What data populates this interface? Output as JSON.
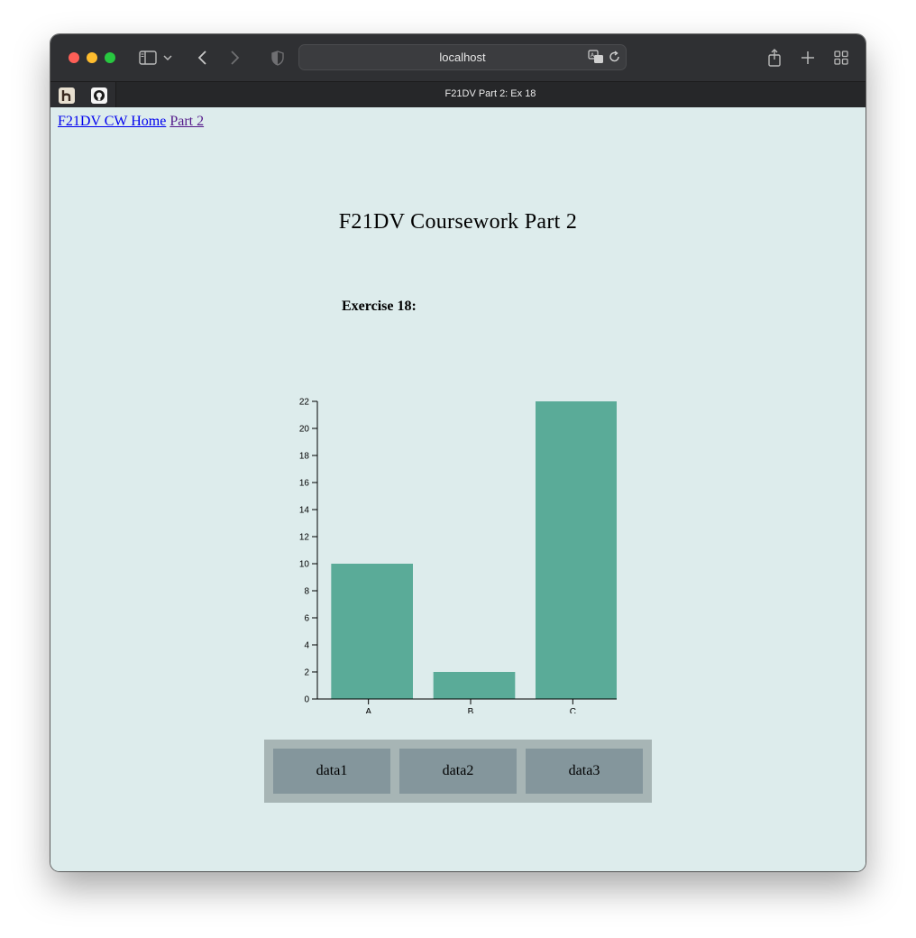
{
  "browser": {
    "url": "localhost",
    "tab_title": "F21DV Part 2: Ex 18"
  },
  "nav": {
    "home_link": "F21DV CW Home",
    "part_link": "Part 2"
  },
  "page": {
    "title": "F21DV Coursework Part 2",
    "exercise": "Exercise 18:"
  },
  "colors": {
    "bar": "#5aab98",
    "background": "#ddecec",
    "button": "#84969c",
    "panel": "#a7b5b5"
  },
  "buttons": [
    "data1",
    "data2",
    "data3"
  ],
  "chart_data": {
    "type": "bar",
    "categories": [
      "A",
      "B",
      "C"
    ],
    "values": [
      10,
      2,
      22
    ],
    "ylim": [
      0,
      22
    ],
    "yticks": [
      0,
      2,
      4,
      6,
      8,
      10,
      12,
      14,
      16,
      18,
      20,
      22
    ],
    "title": "",
    "xlabel": "",
    "ylabel": "",
    "grid": false
  }
}
